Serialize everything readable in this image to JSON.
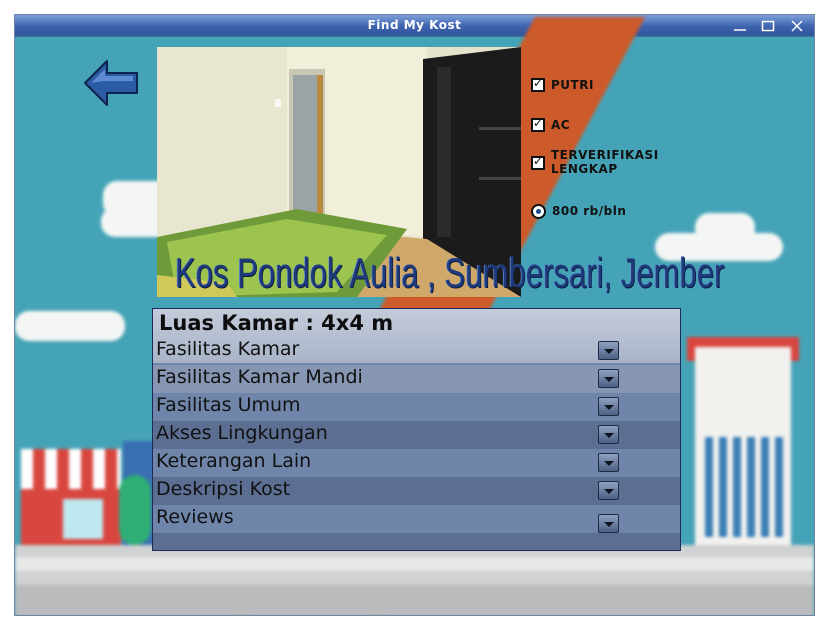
{
  "window": {
    "title": "Find My Kost",
    "controls": [
      "minimize-icon",
      "maximize-icon",
      "close-icon"
    ]
  },
  "navigation": {
    "back_icon": "arrow-left-icon"
  },
  "kost": {
    "name": "Kos Pondok Aulia , Sumbersari, Jember",
    "room_size": "Luas Kamar : 4x4 m"
  },
  "options": [
    {
      "label": "PUTRI",
      "type": "checkbox",
      "checked": true
    },
    {
      "label": "AC",
      "type": "checkbox",
      "checked": true
    },
    {
      "label": "TERVERIFIKASI LENGKAP",
      "type": "checkbox",
      "checked": true
    },
    {
      "label": "800 rb/bln",
      "type": "radio",
      "checked": true
    }
  ],
  "sections": [
    {
      "label": "Fasilitas Kamar",
      "icon": "chevron-down-icon"
    },
    {
      "label": "Fasilitas Kamar Mandi",
      "icon": "chevron-down-icon"
    },
    {
      "label": "Fasilitas Umum",
      "icon": "chevron-down-icon"
    },
    {
      "label": "Akses Lingkungan",
      "icon": "chevron-down-icon"
    },
    {
      "label": "Keterangan Lain",
      "icon": "chevron-down-icon"
    },
    {
      "label": "Deskripsi Kost",
      "icon": "chevron-down-icon"
    },
    {
      "label": "Reviews",
      "icon": "chevron-down-icon"
    }
  ],
  "colors": {
    "titlebar": "#3f65b0",
    "background": "#45a3b7",
    "accent_stripe": "#cc5a2a",
    "panel": "#6e86aa",
    "title_text": "#1e3a7a"
  }
}
